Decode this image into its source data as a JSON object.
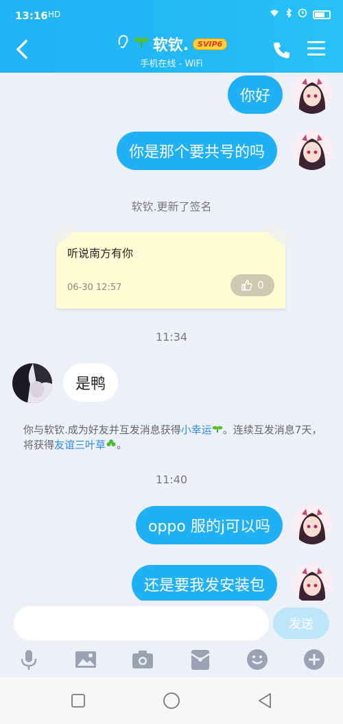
{
  "status_bar": {
    "time": "13:16",
    "network": "HD"
  },
  "header": {
    "title": "软钦.",
    "badge": "SVIP6",
    "subtitle": "手机在线 - WiFi"
  },
  "messages": [
    {
      "side": "right",
      "text": "你好"
    },
    {
      "side": "right",
      "text": "你是那个要共号的吗"
    },
    {
      "side": "left",
      "text": "是鸭"
    },
    {
      "side": "right",
      "text": "oppo 服的j可以吗"
    },
    {
      "side": "right",
      "text": "还是要我发安装包"
    }
  ],
  "notices": {
    "signature_update": "软钦.更新了签名",
    "time_1": "11:34",
    "time_2": "11:40",
    "friendship_part1": "你与软钦.成为好友并互发消息获得",
    "friendship_link1": "小幸运",
    "friendship_part2": "。连续互发消息7天，将获得",
    "friendship_link2": "友谊三叶草",
    "friendship_part3": "。"
  },
  "signature_card": {
    "text": "听说南方有你",
    "date": "06-30 12:57",
    "likes": "0"
  },
  "composer": {
    "placeholder": "",
    "send_label": "发送"
  },
  "colors": {
    "header": "#22b9f6",
    "bubble_self": "#1fb0f5",
    "background": "#eef0f7"
  },
  "icons": [
    "back-icon",
    "ear-icon",
    "sprout-icon",
    "phone-icon",
    "menu-icon",
    "mic-icon",
    "image-icon",
    "camera-icon",
    "red-packet-icon",
    "emoji-icon",
    "plus-icon",
    "square-nav-icon",
    "circle-nav-icon",
    "triangle-nav-icon"
  ]
}
